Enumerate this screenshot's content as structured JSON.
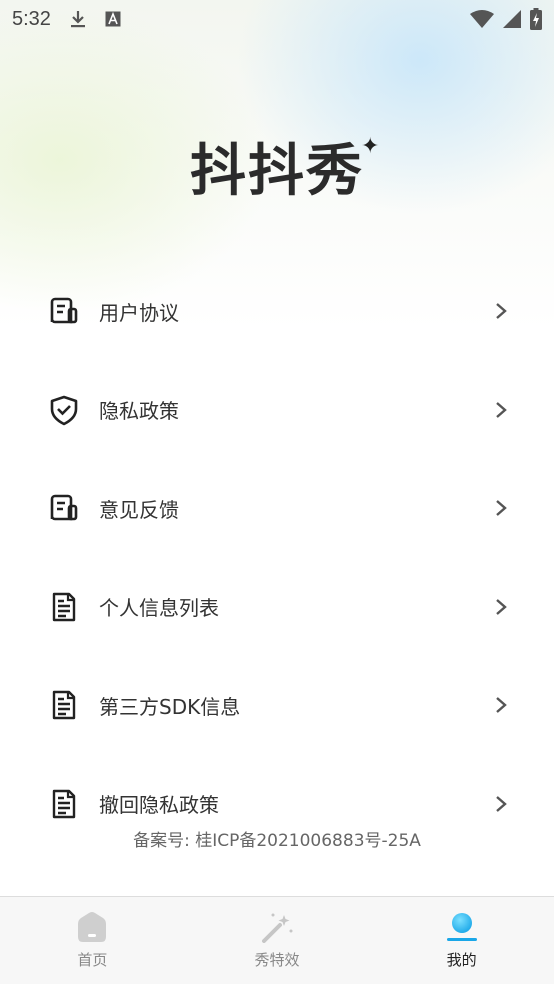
{
  "status_bar": {
    "time": "5:32",
    "icons": [
      "download-icon",
      "keyboard-a-icon",
      "wifi-icon",
      "signal-icon",
      "battery-charging-icon"
    ]
  },
  "app": {
    "logo_text": "抖抖秀",
    "sparkle": "✦"
  },
  "menu": {
    "items": [
      {
        "label": "用户协议",
        "icon": "document-list-icon"
      },
      {
        "label": "隐私政策",
        "icon": "shield-check-icon"
      },
      {
        "label": "意见反馈",
        "icon": "document-list-icon"
      },
      {
        "label": "个人信息列表",
        "icon": "file-lines-icon"
      },
      {
        "label": "第三方SDK信息",
        "icon": "file-lines-icon"
      },
      {
        "label": "撤回隐私政策",
        "icon": "file-lines-icon"
      }
    ]
  },
  "footer": {
    "icp": "备案号: 桂ICP备2021006883号-25A"
  },
  "tabs": [
    {
      "label": "首页",
      "icon": "home-icon",
      "active": false
    },
    {
      "label": "秀特效",
      "icon": "magic-wand-icon",
      "active": false
    },
    {
      "label": "我的",
      "icon": "profile-dot-icon",
      "active": true
    }
  ],
  "colors": {
    "accent": "#1aa7e8",
    "text": "#333333",
    "muted": "#888888"
  }
}
